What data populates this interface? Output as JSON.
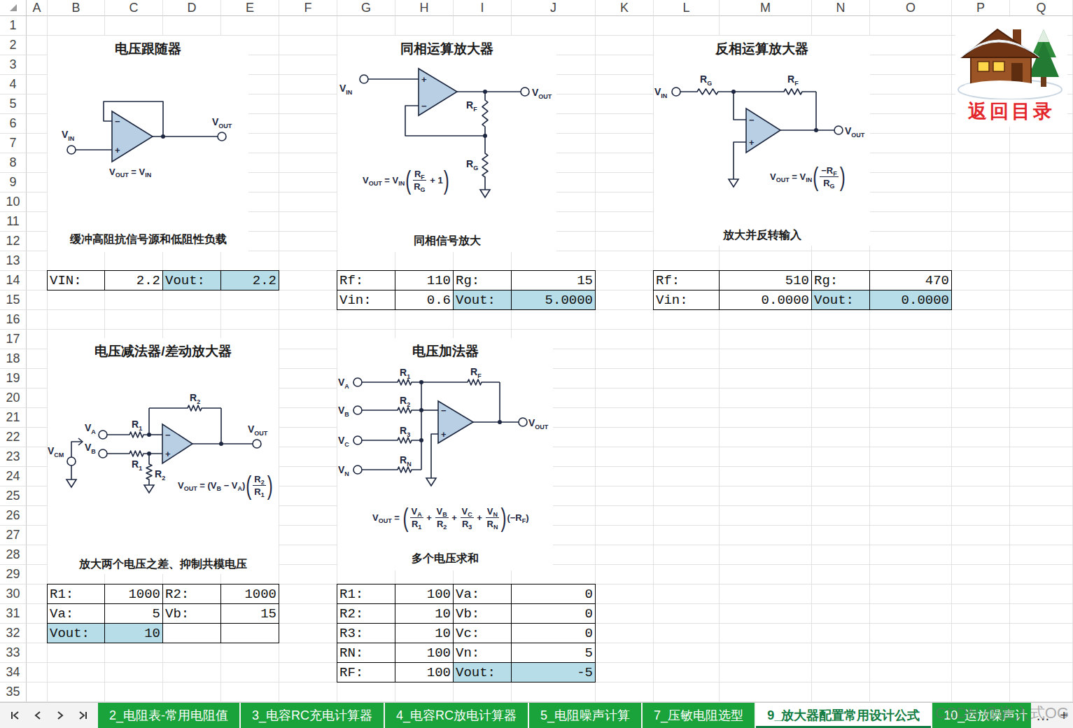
{
  "columns": [
    "A",
    "B",
    "C",
    "D",
    "E",
    "F",
    "G",
    "H",
    "I",
    "J",
    "K",
    "L",
    "M",
    "N",
    "O",
    "P",
    "Q"
  ],
  "rows": [
    "1",
    "2",
    "3",
    "4",
    "5",
    "6",
    "7",
    "8",
    "9",
    "10",
    "11",
    "12",
    "13",
    "14",
    "15",
    "16",
    "17",
    "18",
    "19",
    "20",
    "21",
    "22",
    "23",
    "24",
    "25",
    "26",
    "27",
    "28",
    "29",
    "30",
    "31",
    "32",
    "33",
    "34",
    "35"
  ],
  "opamp": {
    "plus": "+",
    "minus": "−"
  },
  "logo": {
    "text": "返回目录"
  },
  "diagrams": {
    "follower": {
      "title": "电压跟随器",
      "caption": "缓冲高阻抗信号源和低阻性负载",
      "vin": {
        "base": "V",
        "sub": "IN"
      },
      "vout": {
        "base": "V",
        "sub": "OUT"
      },
      "formula": [
        {
          "kind": "sym",
          "base": "V",
          "sub": "OUT"
        },
        {
          "kind": "op",
          "text": " = "
        },
        {
          "kind": "sym",
          "base": "V",
          "sub": "IN"
        }
      ]
    },
    "noninverting": {
      "title": "同相运算放大器",
      "caption": "同相信号放大",
      "vin": {
        "base": "V",
        "sub": "IN"
      },
      "vout": {
        "base": "V",
        "sub": "OUT"
      },
      "rf": {
        "base": "R",
        "sub": "F"
      },
      "rg": {
        "base": "R",
        "sub": "G"
      },
      "formula": [
        {
          "kind": "sym",
          "base": "V",
          "sub": "OUT"
        },
        {
          "kind": "op",
          "text": " = "
        },
        {
          "kind": "sym",
          "base": "V",
          "sub": "IN"
        },
        {
          "kind": "paren",
          "open": "(",
          "close": ")",
          "items": [
            {
              "kind": "frac",
              "num": [
                {
                  "kind": "sym",
                  "base": "R",
                  "sub": "F"
                }
              ],
              "den": [
                {
                  "kind": "sym",
                  "base": "R",
                  "sub": "G"
                }
              ]
            },
            {
              "kind": "op",
              "text": " + 1"
            }
          ]
        }
      ]
    },
    "inverting": {
      "title": "反相运算放大器",
      "caption": "放大并反转输入",
      "vin": {
        "base": "V",
        "sub": "IN"
      },
      "vout": {
        "base": "V",
        "sub": "OUT"
      },
      "rf": {
        "base": "R",
        "sub": "F"
      },
      "rg": {
        "base": "R",
        "sub": "G"
      },
      "formula": [
        {
          "kind": "sym",
          "base": "V",
          "sub": "OUT"
        },
        {
          "kind": "op",
          "text": " = "
        },
        {
          "kind": "sym",
          "base": "V",
          "sub": "IN"
        },
        {
          "kind": "paren",
          "open": "(",
          "close": ")",
          "items": [
            {
              "kind": "frac",
              "num": [
                {
                  "kind": "op",
                  "text": "−"
                },
                {
                  "kind": "sym",
                  "base": "R",
                  "sub": "F"
                }
              ],
              "den": [
                {
                  "kind": "sym",
                  "base": "R",
                  "sub": "G"
                }
              ]
            }
          ]
        }
      ]
    },
    "difference": {
      "title": "电压减法器/差动放大器",
      "caption": "放大两个电压之差、抑制共模电压",
      "va": {
        "base": "V",
        "sub": "A"
      },
      "vb": {
        "base": "V",
        "sub": "B"
      },
      "vcm": {
        "base": "V",
        "sub": "CM"
      },
      "vout": {
        "base": "V",
        "sub": "OUT"
      },
      "r1_top": {
        "base": "R",
        "sub": "1"
      },
      "r1_bottom": {
        "base": "R",
        "sub": "1"
      },
      "r2_feedback": {
        "base": "R",
        "sub": "2"
      },
      "r2_ground": {
        "base": "R",
        "sub": "2"
      },
      "formula": [
        {
          "kind": "sym",
          "base": "V",
          "sub": "OUT"
        },
        {
          "kind": "op",
          "text": " = "
        },
        {
          "kind": "op",
          "text": "("
        },
        {
          "kind": "sym",
          "base": "V",
          "sub": "B"
        },
        {
          "kind": "op",
          "text": " − "
        },
        {
          "kind": "sym",
          "base": "V",
          "sub": "A"
        },
        {
          "kind": "op",
          "text": ")"
        },
        {
          "kind": "paren",
          "open": "(",
          "close": ")",
          "items": [
            {
              "kind": "frac",
              "num": [
                {
                  "kind": "sym",
                  "base": "R",
                  "sub": "2"
                }
              ],
              "den": [
                {
                  "kind": "sym",
                  "base": "R",
                  "sub": "1"
                }
              ]
            }
          ]
        }
      ]
    },
    "summing": {
      "title": "电压加法器",
      "caption": "多个电压求和",
      "inputs": [
        {
          "v": {
            "base": "V",
            "sub": "A"
          },
          "r": {
            "base": "R",
            "sub": "1"
          }
        },
        {
          "v": {
            "base": "V",
            "sub": "B"
          },
          "r": {
            "base": "R",
            "sub": "2"
          }
        },
        {
          "v": {
            "base": "V",
            "sub": "C"
          },
          "r": {
            "base": "R",
            "sub": "3"
          }
        },
        {
          "v": {
            "base": "V",
            "sub": "N"
          },
          "r": {
            "base": "R",
            "sub": "N"
          }
        }
      ],
      "rf": {
        "base": "R",
        "sub": "F"
      },
      "vout": {
        "base": "V",
        "sub": "OUT"
      },
      "formula": [
        {
          "kind": "sym",
          "base": "V",
          "sub": "OUT"
        },
        {
          "kind": "op",
          "text": " = "
        },
        {
          "kind": "paren",
          "open": "(",
          "close": ")",
          "items": [
            {
              "kind": "frac",
              "num": [
                {
                  "kind": "sym",
                  "base": "V",
                  "sub": "A"
                }
              ],
              "den": [
                {
                  "kind": "sym",
                  "base": "R",
                  "sub": "1"
                }
              ]
            },
            {
              "kind": "op",
              "text": " + "
            },
            {
              "kind": "frac",
              "num": [
                {
                  "kind": "sym",
                  "base": "V",
                  "sub": "B"
                }
              ],
              "den": [
                {
                  "kind": "sym",
                  "base": "R",
                  "sub": "2"
                }
              ]
            },
            {
              "kind": "op",
              "text": " + "
            },
            {
              "kind": "frac",
              "num": [
                {
                  "kind": "sym",
                  "base": "V",
                  "sub": "C"
                }
              ],
              "den": [
                {
                  "kind": "sym",
                  "base": "R",
                  "sub": "3"
                }
              ]
            },
            {
              "kind": "op",
              "text": " + "
            },
            {
              "kind": "frac",
              "num": [
                {
                  "kind": "sym",
                  "base": "V",
                  "sub": "N"
                }
              ],
              "den": [
                {
                  "kind": "sym",
                  "base": "R",
                  "sub": "N"
                }
              ]
            }
          ]
        },
        {
          "kind": "op",
          "text": "(−"
        },
        {
          "kind": "sym",
          "base": "R",
          "sub": "F"
        },
        {
          "kind": "op",
          "text": ")"
        }
      ]
    }
  },
  "tables": [
    {
      "rows": [
        [
          {
            "text": "VIN:",
            "kind": "label",
            "highlighted": false
          },
          {
            "text": "2.2",
            "kind": "value",
            "highlighted": false
          },
          {
            "text": "Vout:",
            "kind": "label",
            "highlighted": true
          },
          {
            "text": "2.2",
            "kind": "value",
            "highlighted": true
          }
        ]
      ]
    },
    {
      "rows": [
        [
          {
            "text": "Rf:",
            "kind": "label",
            "highlighted": false
          },
          {
            "text": "110",
            "kind": "value",
            "highlighted": false
          },
          {
            "text": "Rg:",
            "kind": "label",
            "highlighted": false
          },
          {
            "text": "15",
            "kind": "value",
            "highlighted": false
          }
        ],
        [
          {
            "text": "Vin:",
            "kind": "label",
            "highlighted": false
          },
          {
            "text": "0.6",
            "kind": "value",
            "highlighted": false
          },
          {
            "text": "Vout:",
            "kind": "label",
            "highlighted": true
          },
          {
            "text": "5.0000",
            "kind": "value",
            "highlighted": true
          }
        ]
      ]
    },
    {
      "rows": [
        [
          {
            "text": "Rf:",
            "kind": "label",
            "highlighted": false
          },
          {
            "text": "510",
            "kind": "value",
            "highlighted": false
          },
          {
            "text": "Rg:",
            "kind": "label",
            "highlighted": false
          },
          {
            "text": "470",
            "kind": "value",
            "highlighted": false
          }
        ],
        [
          {
            "text": "Vin:",
            "kind": "label",
            "highlighted": false
          },
          {
            "text": "0.0000",
            "kind": "value",
            "highlighted": false
          },
          {
            "text": "Vout:",
            "kind": "label",
            "highlighted": true
          },
          {
            "text": "0.0000",
            "kind": "value",
            "highlighted": true
          }
        ]
      ]
    },
    {
      "rows": [
        [
          {
            "text": "R1:",
            "kind": "label",
            "highlighted": false
          },
          {
            "text": "1000",
            "kind": "value",
            "highlighted": false
          },
          {
            "text": "R2:",
            "kind": "label",
            "highlighted": false
          },
          {
            "text": "1000",
            "kind": "value",
            "highlighted": false
          }
        ],
        [
          {
            "text": "Va:",
            "kind": "label",
            "highlighted": false
          },
          {
            "text": "5",
            "kind": "value",
            "highlighted": false
          },
          {
            "text": "Vb:",
            "kind": "label",
            "highlighted": false
          },
          {
            "text": "15",
            "kind": "value",
            "highlighted": false
          }
        ],
        [
          {
            "text": "Vout:",
            "kind": "label",
            "highlighted": true
          },
          {
            "text": "10",
            "kind": "value",
            "highlighted": true
          },
          {
            "text": "",
            "kind": "label",
            "highlighted": false
          },
          {
            "text": "",
            "kind": "value",
            "highlighted": false
          }
        ]
      ]
    },
    {
      "rows": [
        [
          {
            "text": "R1:",
            "kind": "label",
            "highlighted": false
          },
          {
            "text": "100",
            "kind": "value",
            "highlighted": false
          },
          {
            "text": "Va:",
            "kind": "label",
            "highlighted": false
          },
          {
            "text": "0",
            "kind": "value",
            "highlighted": false
          }
        ],
        [
          {
            "text": "R2:",
            "kind": "label",
            "highlighted": false
          },
          {
            "text": "10",
            "kind": "value",
            "highlighted": false
          },
          {
            "text": "Vb:",
            "kind": "label",
            "highlighted": false
          },
          {
            "text": "0",
            "kind": "value",
            "highlighted": false
          }
        ],
        [
          {
            "text": "R3:",
            "kind": "label",
            "highlighted": false
          },
          {
            "text": "10",
            "kind": "value",
            "highlighted": false
          },
          {
            "text": "Vc:",
            "kind": "label",
            "highlighted": false
          },
          {
            "text": "0",
            "kind": "value",
            "highlighted": false
          }
        ],
        [
          {
            "text": "RN:",
            "kind": "label",
            "highlighted": false
          },
          {
            "text": "100",
            "kind": "value",
            "highlighted": false
          },
          {
            "text": "Vn:",
            "kind": "label",
            "highlighted": false
          },
          {
            "text": "5",
            "kind": "value",
            "highlighted": false
          }
        ],
        [
          {
            "text": "RF:",
            "kind": "label",
            "highlighted": false
          },
          {
            "text": "100",
            "kind": "value",
            "highlighted": false
          },
          {
            "text": "Vout:",
            "kind": "label",
            "highlighted": true
          },
          {
            "text": "-5",
            "kind": "value",
            "highlighted": true
          }
        ]
      ]
    }
  ],
  "tabs": [
    {
      "label": "2_电阻表-常用电阻值",
      "selected": false
    },
    {
      "label": "3_电容RC充电计算器",
      "selected": false
    },
    {
      "label": "4_电容RC放电计算器",
      "selected": false
    },
    {
      "label": "5_电阻噪声计算",
      "selected": false
    },
    {
      "label": "7_压敏电阻选型",
      "selected": false
    },
    {
      "label": "9_放大器配置常用设计公式",
      "selected": true
    },
    {
      "label": "10_运放噪声计",
      "selected": false
    }
  ],
  "more": "…",
  "add": "+",
  "watermark": "CSDN @嵌入式OG"
}
